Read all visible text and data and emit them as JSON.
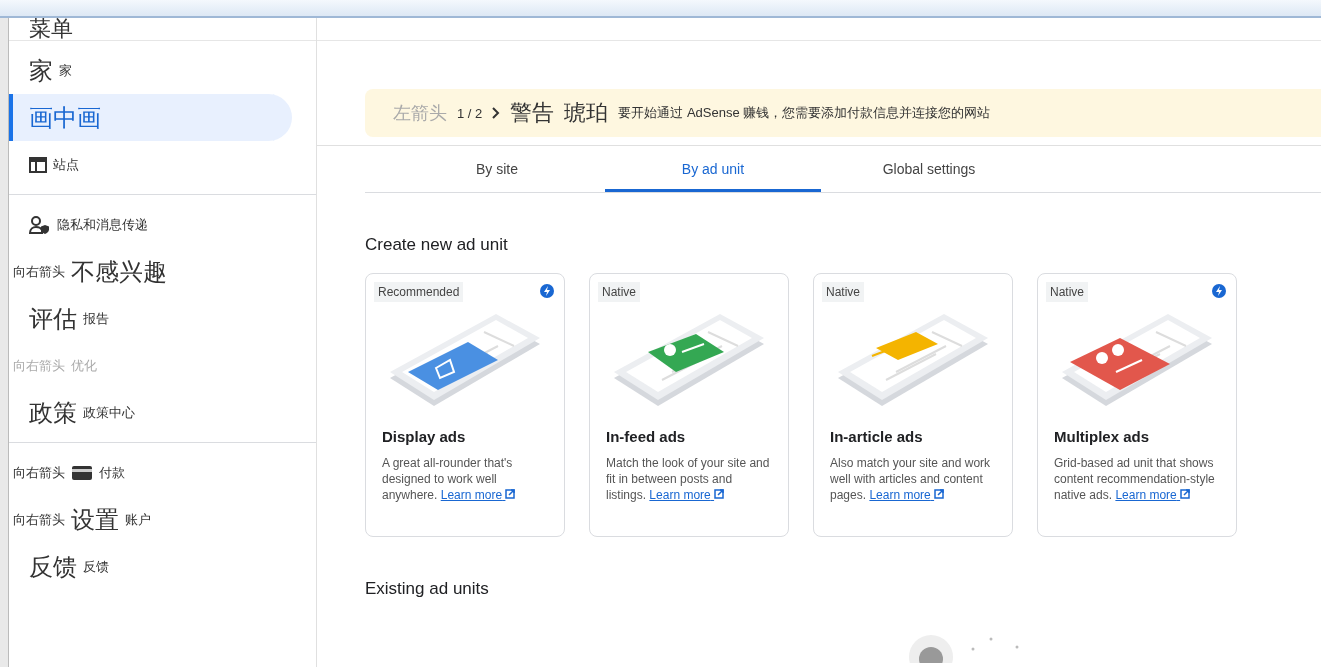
{
  "header": {
    "menu_icon_text": "菜单"
  },
  "sidebar": {
    "groups": [
      {
        "items": [
          {
            "icon_text": "家",
            "label": "家",
            "selected": false,
            "disabled": false
          },
          {
            "icon_text": "画中画",
            "selected": true,
            "disabled": false
          },
          {
            "label": "站点",
            "selected": false,
            "disabled": false
          }
        ]
      },
      {
        "items": [
          {
            "label": "隐私和消息传递",
            "selected": false,
            "disabled": false
          },
          {
            "arrow_text": "向右箭头",
            "icon_text": "不感兴趣",
            "selected": false,
            "disabled": false
          },
          {
            "icon_text": "评估",
            "label": "报告",
            "selected": false,
            "disabled": false
          },
          {
            "arrow_text": "向右箭头",
            "label": "优化",
            "selected": false,
            "disabled": true
          },
          {
            "icon_text": "政策",
            "label": "政策中心",
            "selected": false,
            "disabled": false
          }
        ]
      },
      {
        "items": [
          {
            "arrow_text": "向右箭头",
            "label": "付款",
            "selected": false,
            "disabled": false
          },
          {
            "arrow_text": "向右箭头",
            "icon_text": "设置",
            "label": "账户",
            "selected": false,
            "disabled": false
          },
          {
            "icon_text": "反馈",
            "label": "反馈",
            "selected": false,
            "disabled": false
          }
        ]
      }
    ]
  },
  "banner": {
    "prev_text": "左箭头",
    "counter": "1 / 2",
    "icon_text": "警告",
    "icon_color_text": "琥珀",
    "message": "要开始通过 AdSense 赚钱，您需要添加付款信息并连接您的网站"
  },
  "tabs": [
    {
      "label": "By site",
      "selected": false
    },
    {
      "label": "By ad unit",
      "selected": true
    },
    {
      "label": "Global settings",
      "selected": false
    }
  ],
  "create_section": {
    "title": "Create new ad unit",
    "cards": [
      {
        "tag": "Recommended",
        "flag": true,
        "color": "#4a90e2",
        "kind": "display",
        "title": "Display ads",
        "description": "A great all-rounder that's designed to work well anywhere.",
        "link": "Learn more"
      },
      {
        "tag": "Native",
        "flag": false,
        "color": "#34a853",
        "kind": "feed",
        "title": "In-feed ads",
        "description": "Match the look of your site and fit in between posts and listings.",
        "link": "Learn more"
      },
      {
        "tag": "Native",
        "flag": false,
        "color": "#f4b400",
        "kind": "article",
        "title": "In-article ads",
        "description": "Also match your site and work well with articles and content pages.",
        "link": "Learn more"
      },
      {
        "tag": "Native",
        "flag": true,
        "color": "#e2574c",
        "kind": "multiplex",
        "title": "Multiplex ads",
        "description": "Grid-based ad unit that shows content recommendation-style native ads.",
        "link": "Learn more"
      }
    ]
  },
  "existing_section": {
    "title": "Existing ad units"
  }
}
